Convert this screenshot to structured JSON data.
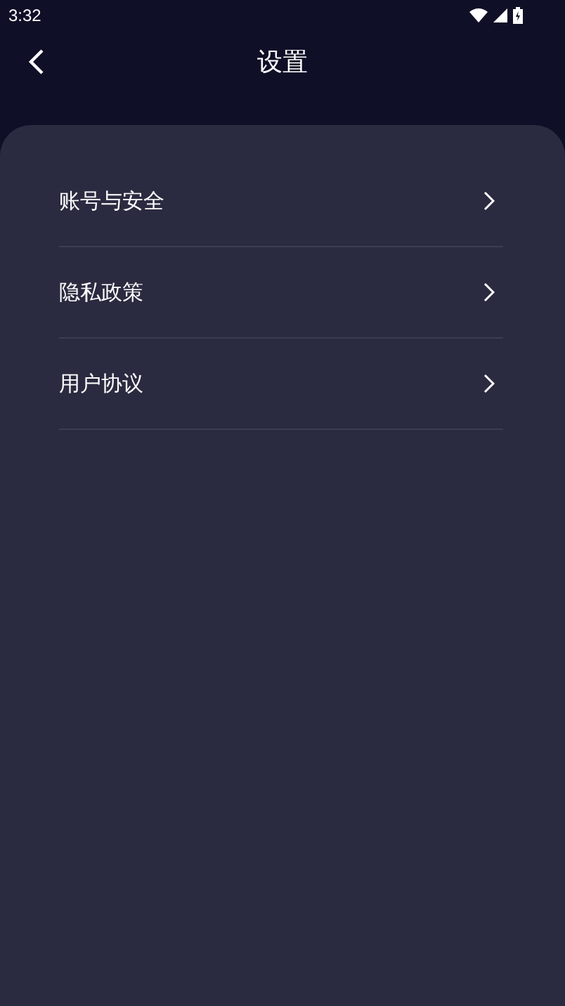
{
  "status_bar": {
    "time": "3:32"
  },
  "header": {
    "title": "设置"
  },
  "menu": [
    {
      "label": "账号与安全"
    },
    {
      "label": "隐私政策"
    },
    {
      "label": "用户协议"
    }
  ]
}
